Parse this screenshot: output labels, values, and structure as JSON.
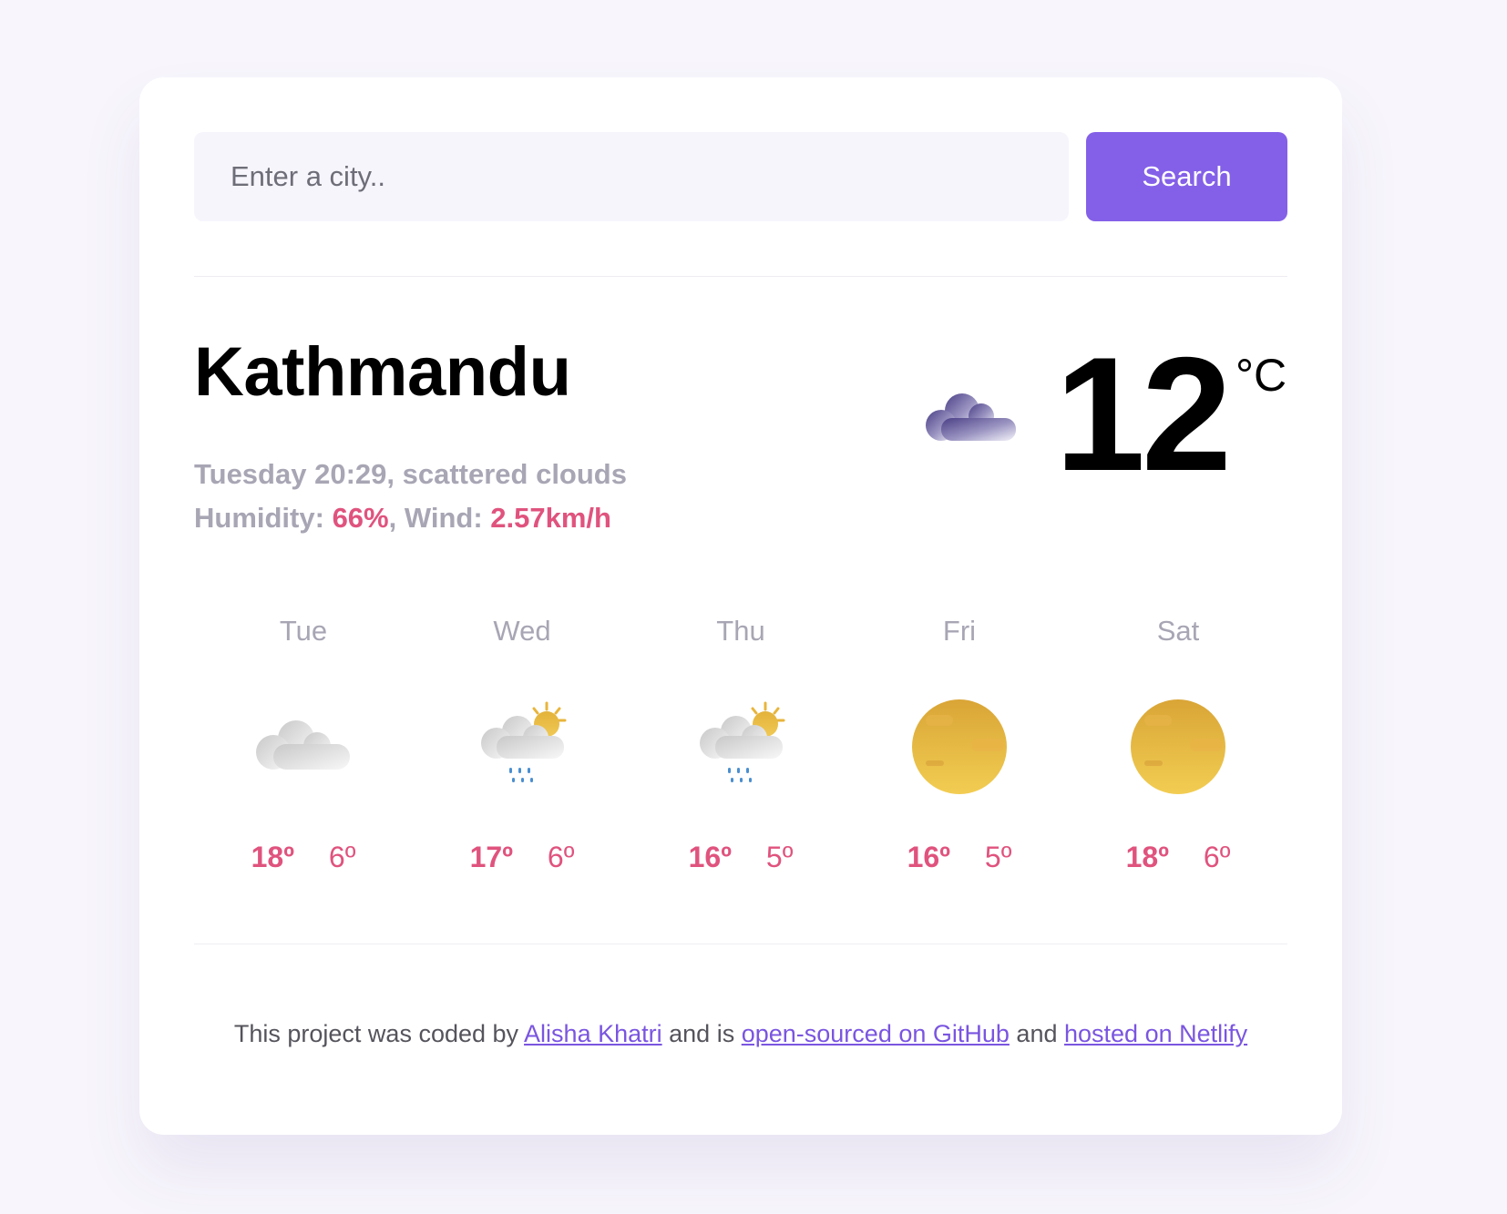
{
  "search": {
    "placeholder": "Enter a city..",
    "button_label": "Search"
  },
  "current": {
    "city": "Kathmandu",
    "day_time": "Tuesday 20:29",
    "description": "scattered clouds",
    "humidity_label": "Humidity:",
    "humidity_value": "66%",
    "wind_label": "Wind:",
    "wind_value": "2.57km/h",
    "temperature": "12",
    "unit": "°C",
    "icon": "scattered-clouds-night-icon"
  },
  "forecast": [
    {
      "day": "Tue",
      "max": "18º",
      "min": "6º",
      "icon": "cloudy-icon"
    },
    {
      "day": "Wed",
      "max": "17º",
      "min": "6º",
      "icon": "rain-sun-icon"
    },
    {
      "day": "Thu",
      "max": "16º",
      "min": "5º",
      "icon": "rain-sun-icon"
    },
    {
      "day": "Fri",
      "max": "16º",
      "min": "5º",
      "icon": "sun-icon"
    },
    {
      "day": "Sat",
      "max": "18º",
      "min": "6º",
      "icon": "sun-icon"
    }
  ],
  "footer": {
    "text_1": "This project was coded by",
    "author_link": "Alisha Khatri",
    "text_2": "and is",
    "github_link": "open-sourced on GitHub",
    "text_3": "and",
    "netlify_link": "hosted on Netlify"
  },
  "colors": {
    "accent": "#8460e8",
    "highlight": "#e0537e",
    "muted": "#a8a6b4"
  }
}
